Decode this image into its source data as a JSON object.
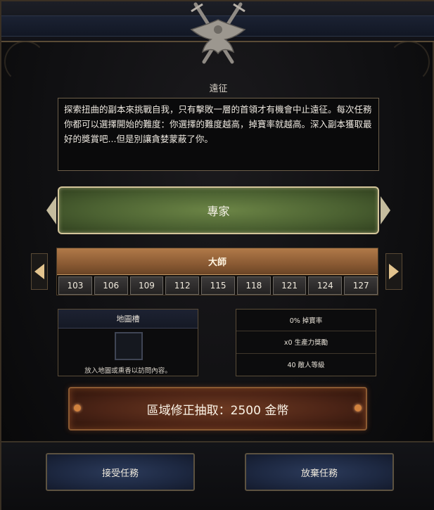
{
  "window": {
    "title": "遠征"
  },
  "description": "探索扭曲的副本來挑戰自我，只有擊敗一層的首領才有機會中止遠征。每次任務你都可以選擇開始的難度：你選擇的難度越高，掉寶率就越高。深入副本獲取最好的獎賞吧...但是別讓貪婪蒙蔽了你。",
  "difficulty": {
    "label": "專家"
  },
  "tier": {
    "label": "大師",
    "levels": [
      "103",
      "106",
      "109",
      "112",
      "115",
      "118",
      "121",
      "124",
      "127"
    ]
  },
  "map_slot": {
    "title": "地圖槽",
    "hint": "放入地圖或熏香以訪問內容。"
  },
  "stats": {
    "drop_rate": "0% 掉寶率",
    "productivity": "x0 生產力獎勵",
    "enemy_level": "40 敵人等級"
  },
  "cost_button": {
    "label": "區域修正抽取：2500 金幣"
  },
  "footer": {
    "accept_label": "接受任務",
    "abandon_label": "放棄任務"
  },
  "colors": {
    "difficulty_green": "#4c6232",
    "tier_bronze": "#8a5a33",
    "cost_orange": "#6e3a22",
    "footer_blue": "#1d2841",
    "arrow_gold": "#e3c48e"
  },
  "icons": {
    "emblem": "crossed-swords-eagle-icon",
    "prev": "arrow-left-icon",
    "next": "arrow-right-icon"
  }
}
